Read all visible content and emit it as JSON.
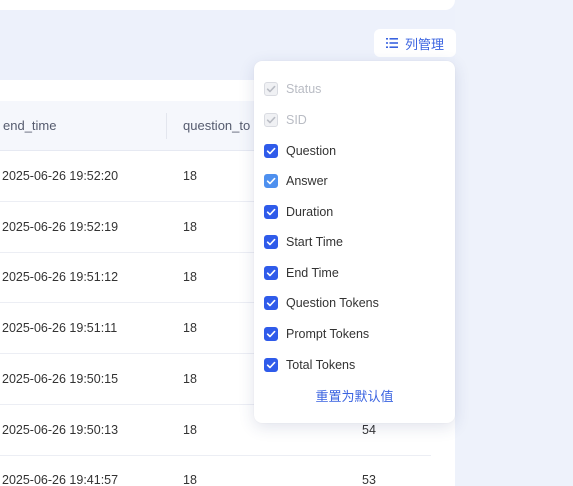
{
  "toolbar": {
    "column_manage_label": "列管理",
    "column_manage_icon": "list-icon"
  },
  "table": {
    "columns": [
      "end_time",
      "question_to"
    ],
    "rows": [
      {
        "end_time": "2025-06-26 19:52:20",
        "question_tokens": "18",
        "extra": ""
      },
      {
        "end_time": "2025-06-26 19:52:19",
        "question_tokens": "18",
        "extra": ""
      },
      {
        "end_time": "2025-06-26 19:51:12",
        "question_tokens": "18",
        "extra": ""
      },
      {
        "end_time": "2025-06-26 19:51:11",
        "question_tokens": "18",
        "extra": ""
      },
      {
        "end_time": "2025-06-26 19:50:15",
        "question_tokens": "18",
        "extra": ""
      },
      {
        "end_time": "2025-06-26 19:50:13",
        "question_tokens": "18",
        "extra": "54"
      },
      {
        "end_time": "2025-06-26 19:41:57",
        "question_tokens": "18",
        "extra": "53"
      }
    ]
  },
  "column_popover": {
    "options": [
      {
        "label": "Status",
        "checked": true,
        "disabled": true
      },
      {
        "label": "SID",
        "checked": true,
        "disabled": true
      },
      {
        "label": "Question",
        "checked": true,
        "disabled": false
      },
      {
        "label": "Answer",
        "checked": true,
        "disabled": false,
        "light": true
      },
      {
        "label": "Duration",
        "checked": true,
        "disabled": false
      },
      {
        "label": "Start Time",
        "checked": true,
        "disabled": false
      },
      {
        "label": "End Time",
        "checked": true,
        "disabled": false
      },
      {
        "label": "Question Tokens",
        "checked": true,
        "disabled": false
      },
      {
        "label": "Prompt Tokens",
        "checked": true,
        "disabled": false
      },
      {
        "label": "Total Tokens",
        "checked": true,
        "disabled": false
      }
    ],
    "reset_label": "重置为默认值"
  },
  "colors": {
    "accent": "#2f5bea",
    "link": "#3a63e0",
    "background": "#edf1fb"
  }
}
